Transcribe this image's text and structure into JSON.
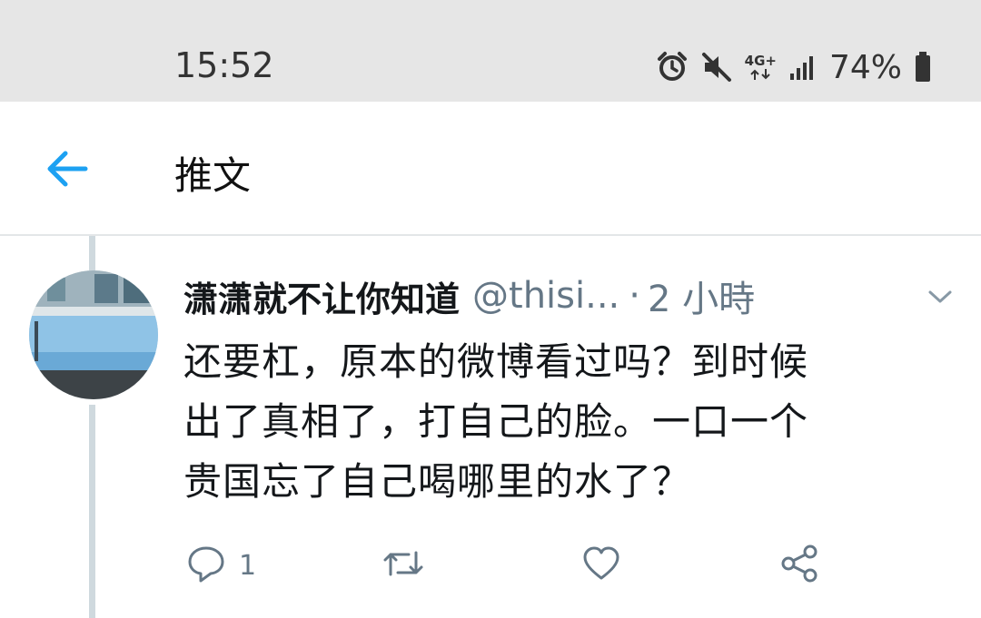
{
  "status_bar": {
    "time": "15:52",
    "network": "4G+",
    "battery_percent": "74%",
    "icons": [
      "alarm-icon",
      "mute-icon",
      "network-4g-icon",
      "signal-icon",
      "battery-icon"
    ]
  },
  "header": {
    "title": "推文",
    "back_icon": "back-arrow-icon",
    "accent_color": "#1da1f2"
  },
  "tweet": {
    "display_name": "潇潇就不让你知道",
    "handle": "@thisi...",
    "separator": "·",
    "time_ago": "2 小時",
    "text_lines": [
      "还要杠，原本的微博看过吗？到时候",
      "出了真相了，打自己的脸。一口一个",
      "贵国忘了自己喝哪里的水了？"
    ],
    "actions": {
      "reply_count": "1"
    }
  },
  "colors": {
    "status_bar_bg": "#e6e6e6",
    "thread_line": "#cfd9de",
    "secondary_text": "#657786"
  }
}
